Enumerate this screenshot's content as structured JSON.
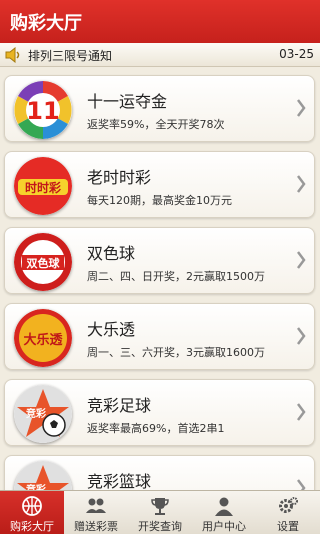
{
  "header": {
    "title": "购彩大厅"
  },
  "notice": {
    "text": "排列三限号通知",
    "date": "03-25",
    "icon": "speaker-icon"
  },
  "lotteries": [
    {
      "name": "十一运夺金",
      "desc": "返奖率59%，全天开奖78次",
      "logo_text": "11"
    },
    {
      "name": "老时时彩",
      "desc": "每天120期，最高奖金10万元",
      "logo_text": "时时彩"
    },
    {
      "name": "双色球",
      "desc": "周二、四、日开奖，2元赢取1500万",
      "logo_text": "双色球"
    },
    {
      "name": "大乐透",
      "desc": "周一、三、六开奖，3元赢取1600万",
      "logo_text": "大乐透"
    },
    {
      "name": "竞彩足球",
      "desc": "返奖率最高69%，首选2串1",
      "logo_text": "竞彩"
    },
    {
      "name": "竞彩篮球",
      "desc": "",
      "logo_text": "竞彩"
    }
  ],
  "tabs": [
    {
      "label": "购彩大厅",
      "icon": "basketball-icon",
      "active": true
    },
    {
      "label": "赠送彩票",
      "icon": "users-icon",
      "active": false
    },
    {
      "label": "开奖查询",
      "icon": "trophy-icon",
      "active": false
    },
    {
      "label": "用户中心",
      "icon": "user-icon",
      "active": false
    },
    {
      "label": "设置",
      "icon": "gear-icon",
      "active": false
    }
  ],
  "colors": {
    "brand_red": "#d0251f",
    "background": "#f1ece0"
  }
}
